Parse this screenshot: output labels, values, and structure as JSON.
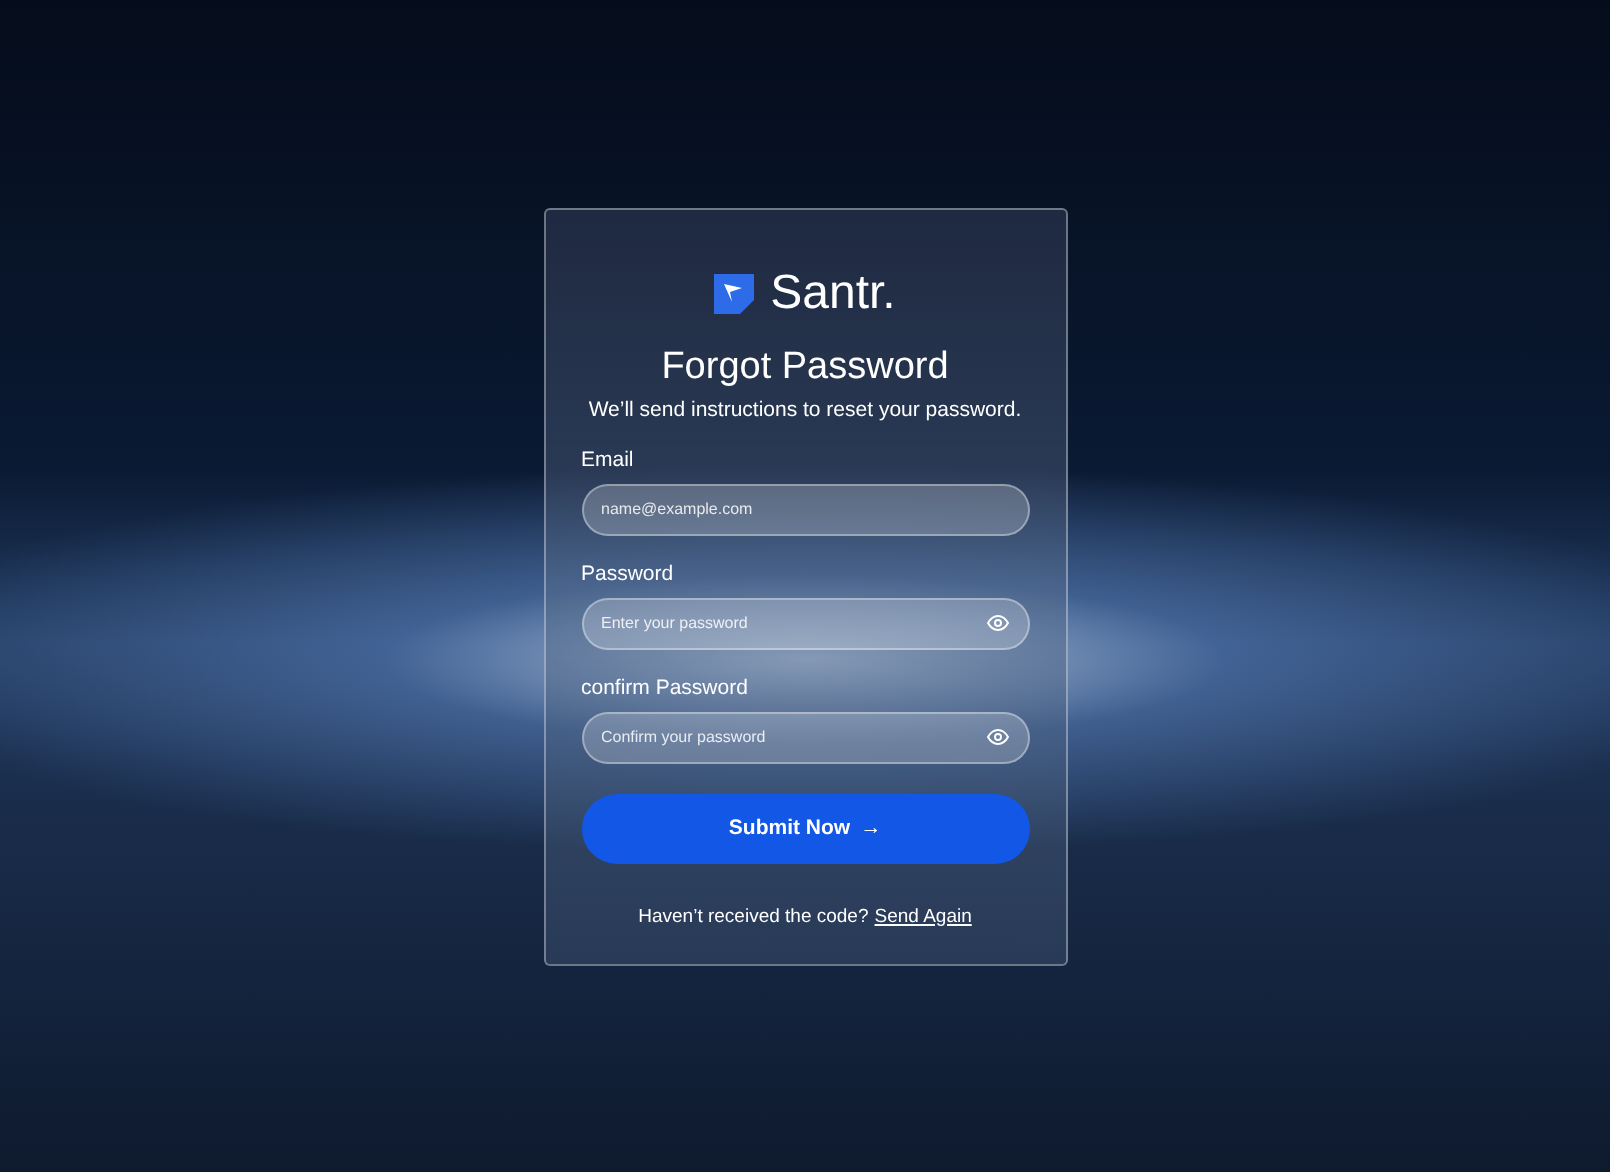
{
  "brand": {
    "name": "Santr."
  },
  "heading": "Forgot Password",
  "subtitle": "We’ll send instructions to reset your password.",
  "fields": [
    {
      "kind": "text",
      "label": "Email",
      "placeholder": "name@example.com"
    },
    {
      "kind": "password",
      "label": "Password",
      "placeholder": "Enter your password"
    },
    {
      "kind": "password",
      "label": "confirm Password",
      "placeholder": "Confirm your password"
    }
  ],
  "submit": {
    "label": "Submit Now",
    "icon": "→"
  },
  "footer": {
    "text": "Haven’t received the code?",
    "link": "Send Again"
  }
}
